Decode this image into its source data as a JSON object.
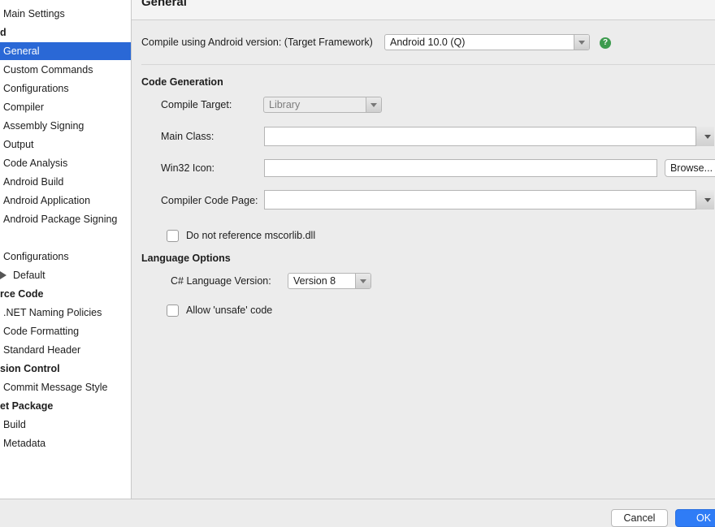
{
  "sidebar": {
    "items": [
      {
        "label": "Main Settings",
        "kind": "item"
      },
      {
        "label": "d",
        "kind": "header"
      },
      {
        "label": "General",
        "kind": "item",
        "selected": true
      },
      {
        "label": "Custom Commands",
        "kind": "item"
      },
      {
        "label": "Configurations",
        "kind": "item"
      },
      {
        "label": "Compiler",
        "kind": "item"
      },
      {
        "label": "Assembly Signing",
        "kind": "item"
      },
      {
        "label": "Output",
        "kind": "item"
      },
      {
        "label": "Code Analysis",
        "kind": "item"
      },
      {
        "label": "Android Build",
        "kind": "item"
      },
      {
        "label": "Android Application",
        "kind": "item"
      },
      {
        "label": "Android Package Signing",
        "kind": "item"
      },
      {
        "label": "",
        "kind": "spacer"
      },
      {
        "label": "Configurations",
        "kind": "item"
      },
      {
        "label": "Default",
        "kind": "child"
      },
      {
        "label": "rce Code",
        "kind": "header"
      },
      {
        "label": ".NET Naming Policies",
        "kind": "item"
      },
      {
        "label": "Code Formatting",
        "kind": "item"
      },
      {
        "label": "Standard Header",
        "kind": "item"
      },
      {
        "label": "sion Control",
        "kind": "header"
      },
      {
        "label": "Commit Message Style",
        "kind": "item"
      },
      {
        "label": "et Package",
        "kind": "header"
      },
      {
        "label": "Build",
        "kind": "item"
      },
      {
        "label": "Metadata",
        "kind": "item"
      }
    ],
    "selected_color": "#2a68d6"
  },
  "page": {
    "title": "General",
    "compile_label": "Compile using Android version: (Target Framework)",
    "compile_value": "Android 10.0 (Q)",
    "help_glyph": "?",
    "help_icon": "help-icon",
    "code_generation": {
      "heading": "Code Generation",
      "compile_target_label": "Compile Target:",
      "compile_target_value": "Library",
      "main_class_label": "Main Class:",
      "main_class_value": "",
      "win32_icon_label": "Win32 Icon:",
      "win32_icon_value": "",
      "browse_label": "Browse...",
      "compiler_code_page_label": "Compiler Code Page:",
      "compiler_code_page_value": "",
      "no_mscorlib_label": "Do not reference mscorlib.dll",
      "no_mscorlib_checked": false
    },
    "language_options": {
      "heading": "Language Options",
      "csharp_version_label": "C# Language Version:",
      "csharp_version_value": "Version 8",
      "allow_unsafe_label": "Allow 'unsafe' code",
      "allow_unsafe_checked": false
    }
  },
  "footer": {
    "cancel_label": "Cancel",
    "ok_label": "OK",
    "ok_color": "#2f7cf6"
  }
}
